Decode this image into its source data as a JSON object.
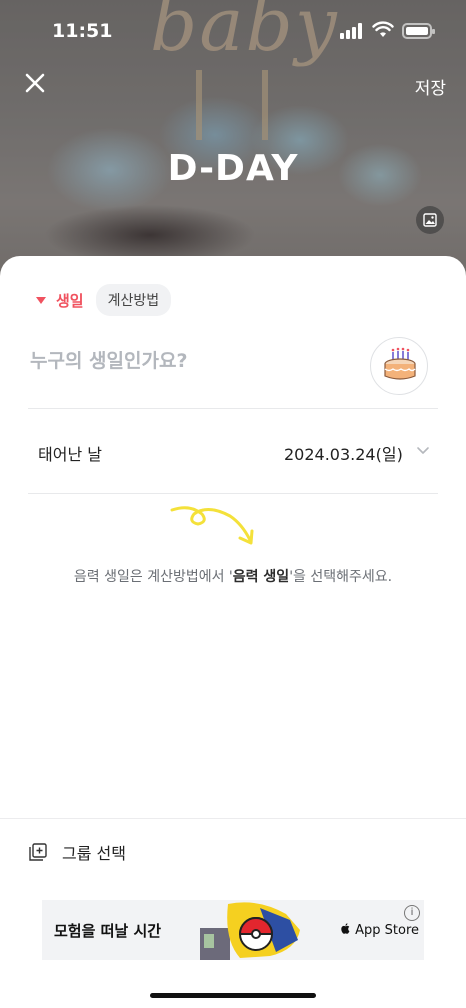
{
  "status_bar": {
    "time": "11:51"
  },
  "header": {
    "save_label": "저장",
    "title": "D-DAY",
    "background_lettering": "baby"
  },
  "type_selector": {
    "type_label": "생일",
    "calc_button_label": "계산방법"
  },
  "name_field": {
    "placeholder": "누구의 생일인가요?",
    "value": ""
  },
  "birth_date": {
    "label": "태어난 날",
    "value": "2024.03.24(일)"
  },
  "hint": {
    "prefix": "음력 생일은 계산방법에서 '",
    "emphasis": "음력 생일",
    "suffix": "'을 선택해주세요."
  },
  "group": {
    "label": "그룹 선택"
  },
  "ad": {
    "title": "모험을 떠날 시간",
    "store_label": "App Store",
    "info_glyph": "i"
  },
  "colors": {
    "accent": "#f0525f",
    "doodle": "#f4e13a",
    "muted_text": "#6b6f75"
  },
  "icons": [
    "close-icon",
    "photo-icon",
    "cake-icon",
    "chevron-down-icon",
    "group-add-icon",
    "apple-icon",
    "info-icon"
  ]
}
